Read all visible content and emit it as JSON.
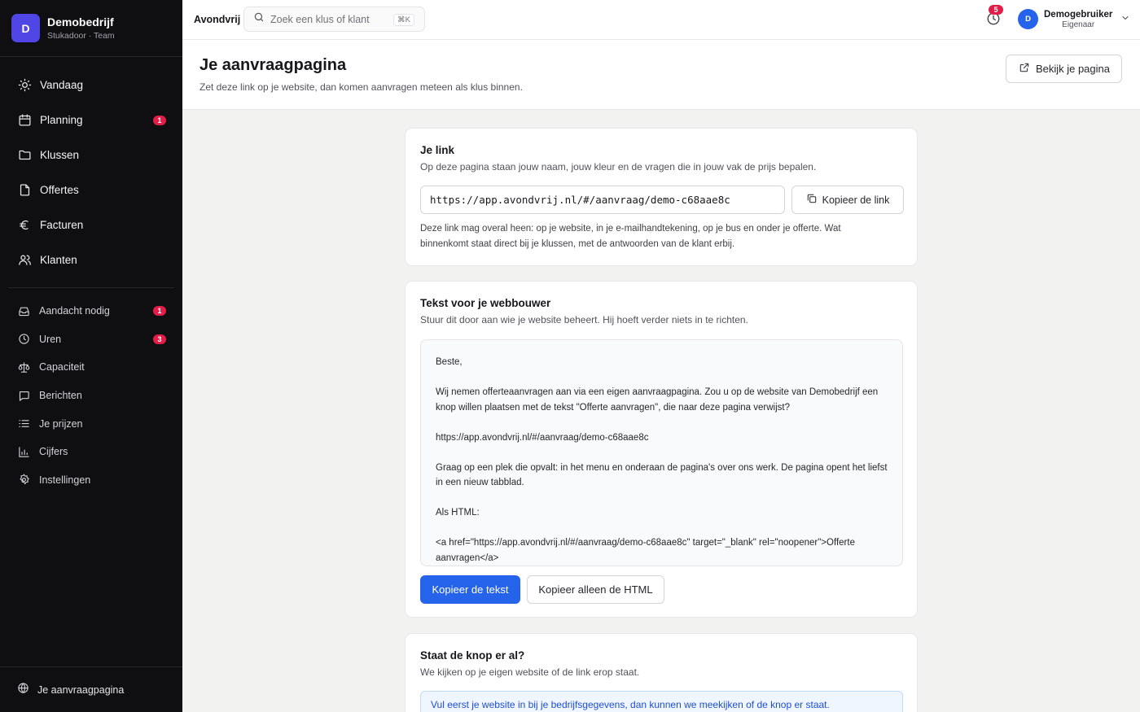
{
  "brand": {
    "initial": "D",
    "name": "Demobedrijf",
    "subtitle": "Stukadoor · Team"
  },
  "nav_main": [
    {
      "label": "Vandaag",
      "icon": "sun-icon"
    },
    {
      "label": "Planning",
      "icon": "calendar-icon",
      "badge": "1"
    },
    {
      "label": "Klussen",
      "icon": "folder-icon"
    },
    {
      "label": "Offertes",
      "icon": "file-icon"
    },
    {
      "label": "Facturen",
      "icon": "euro-icon"
    },
    {
      "label": "Klanten",
      "icon": "users-icon"
    }
  ],
  "nav_secondary": [
    {
      "label": "Aandacht nodig",
      "icon": "inbox-icon",
      "badge": "1"
    },
    {
      "label": "Uren",
      "icon": "clock-icon",
      "badge": "3"
    },
    {
      "label": "Capaciteit",
      "icon": "scale-icon"
    },
    {
      "label": "Berichten",
      "icon": "message-icon"
    },
    {
      "label": "Je prijzen",
      "icon": "list-icon"
    },
    {
      "label": "Cijfers",
      "icon": "bar-chart-icon"
    },
    {
      "label": "Instellingen",
      "icon": "gear-icon"
    }
  ],
  "sidebar_footer": {
    "label": "Je aanvraagpagina",
    "icon": "globe-icon"
  },
  "topbar": {
    "app_name": "Avondvrij",
    "search_placeholder": "Zoek een klus of klant",
    "search_shortcut": "⌘K",
    "notification_count": "5",
    "user": {
      "initial": "D",
      "name": "Demogebruiker",
      "role": "Eigenaar"
    }
  },
  "page": {
    "title": "Je aanvraagpagina",
    "subtitle": "Zet deze link op je website, dan komen aanvragen meteen als klus binnen.",
    "view_button": "Bekijk je pagina"
  },
  "link_card": {
    "title": "Je link",
    "description": "Op deze pagina staan jouw naam, jouw kleur en de vragen die in jouw vak de prijs bepalen.",
    "url": "https://app.avondvrij.nl/#/aanvraag/demo-c68aae8c",
    "copy_button": "Kopieer de link",
    "note": "Deze link mag overal heen: op je website, in je e-mailhandtekening, op je bus en onder je offerte. Wat binnenkomt staat direct bij je klussen, met de antwoorden van de klant erbij."
  },
  "builder_card": {
    "title": "Tekst voor je webbouwer",
    "description": "Stuur dit door aan wie je website beheert. Hij hoeft verder niets in te richten.",
    "message": [
      "Beste,",
      "Wij nemen offerteaanvragen aan via een eigen aanvraagpagina. Zou u op de website van Demobedrijf een knop willen plaatsen met de tekst \"Offerte aanvragen\", die naar deze pagina verwijst?",
      "https://app.avondvrij.nl/#/aanvraag/demo-c68aae8c",
      "Graag op een plek die opvalt: in het menu en onderaan de pagina's over ons werk. De pagina opent het liefst in een nieuw tabblad.",
      "Als HTML:",
      "<a href=\"https://app.avondvrij.nl/#/aanvraag/demo-c68aae8c\" target=\"_blank\" rel=\"noopener\">Offerte aanvragen</a>"
    ],
    "copy_text_button": "Kopieer de tekst",
    "copy_html_button": "Kopieer alleen de HTML"
  },
  "check_card": {
    "title": "Staat de knop er al?",
    "description": "We kijken op je eigen website of de link erop staat.",
    "info": "Vul eerst je website in bij je bedrijfsgegevens, dan kunnen we meekijken of de knop er staat."
  },
  "colors": {
    "accent": "#2563eb",
    "brand": "#4f46e5",
    "badge": "#e11d48",
    "sidebar_bg": "#0f0f12"
  }
}
